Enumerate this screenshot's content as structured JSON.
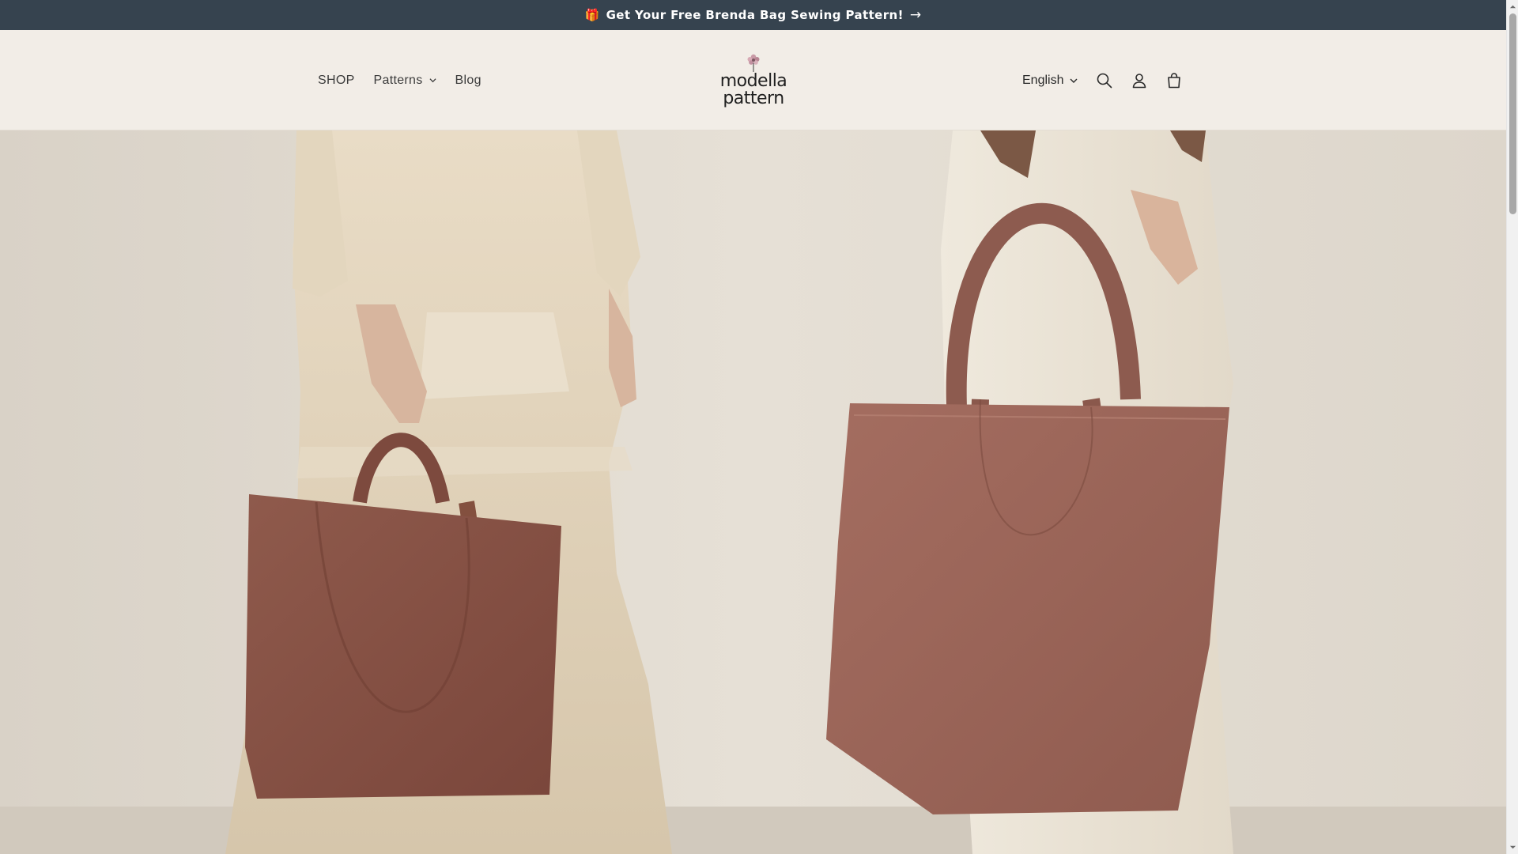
{
  "announcement": {
    "gift_icon": "gift-icon",
    "text": "Get Your Free Brenda Bag Sewing Pattern!",
    "arrow_icon": "arrow-right-icon"
  },
  "header": {
    "nav": [
      {
        "label": "SHOP",
        "has_dropdown": false
      },
      {
        "label": "Patterns",
        "has_dropdown": true
      },
      {
        "label": "Blog",
        "has_dropdown": false
      }
    ],
    "logo": {
      "line1": "modella",
      "line2": "pattern",
      "icon": "flower-icon"
    },
    "language": {
      "selected": "English"
    },
    "icons": [
      "search-icon",
      "account-icon",
      "cart-icon"
    ]
  },
  "hero": {
    "image": "two-women-holding-brown-canvas-tote-bags"
  },
  "colors": {
    "announcement_bg": "#36434f",
    "header_bg": "#f2ede7",
    "text": "#2a2a2a",
    "bag_left": "#8a5347",
    "bag_right": "#9a6458"
  }
}
